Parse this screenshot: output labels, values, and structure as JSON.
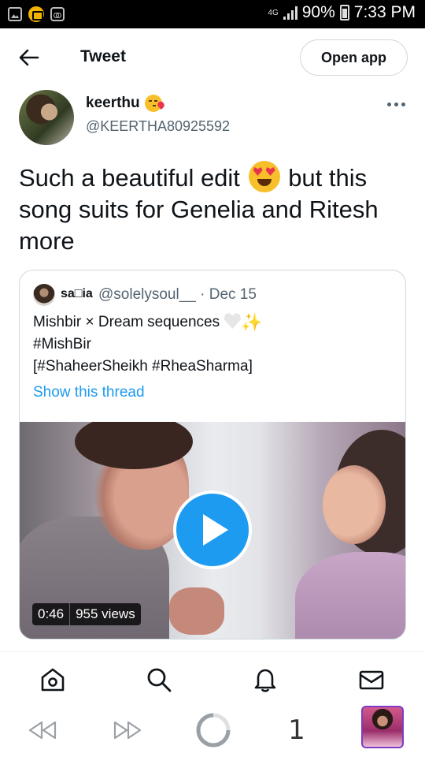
{
  "status_bar": {
    "network": "4G",
    "battery": "90%",
    "time": "7:33 PM"
  },
  "header": {
    "title": "Tweet",
    "open_app": "Open app"
  },
  "tweet": {
    "author_name": "keerthu",
    "author_handle": "@KEERTHA80925592",
    "text_part1": "Such a beautiful edit",
    "text_part2": "but this song suits  for Genelia and Ritesh more"
  },
  "quoted_tweet": {
    "name": "sa□ia",
    "handle_date": "@solelysoul__ · Dec 15",
    "line1": "Mishbir × Dream sequences",
    "line2": "#MishBir",
    "line3": "[#ShaheerSheikh #RheaSharma]",
    "show_thread": "Show this thread",
    "video": {
      "duration": "0:46",
      "views": "955 views"
    }
  },
  "browser": {
    "tab_count": "1"
  },
  "colors": {
    "accent": "#1d9bf0",
    "text": "#0f1419",
    "secondary_text": "#536471",
    "border": "#cfd9de"
  }
}
